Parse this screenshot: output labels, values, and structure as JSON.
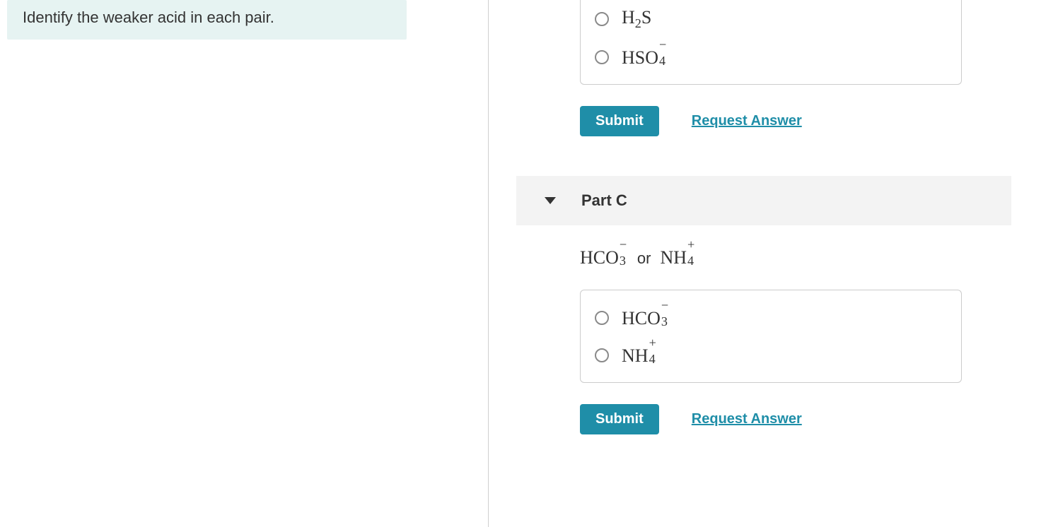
{
  "question": {
    "text": "Identify the weaker acid in each pair."
  },
  "partB": {
    "options": {
      "opt1": {
        "base": "H",
        "sub1": "2",
        "rest": "S"
      },
      "opt2": {
        "base": "HSO",
        "sup": "−",
        "sub": "4"
      }
    },
    "submit": "Submit",
    "request": "Request Answer"
  },
  "partC": {
    "title": "Part C",
    "prompt": {
      "a": {
        "base": "HCO",
        "sup": "−",
        "sub": "3"
      },
      "or": "or",
      "b": {
        "base": "NH",
        "sup": "+",
        "sub": "4"
      }
    },
    "options": {
      "opt1": {
        "base": "HCO",
        "sup": "−",
        "sub": "3"
      },
      "opt2": {
        "base": "NH",
        "sup": "+",
        "sub": "4"
      }
    },
    "submit": "Submit",
    "request": "Request Answer"
  }
}
